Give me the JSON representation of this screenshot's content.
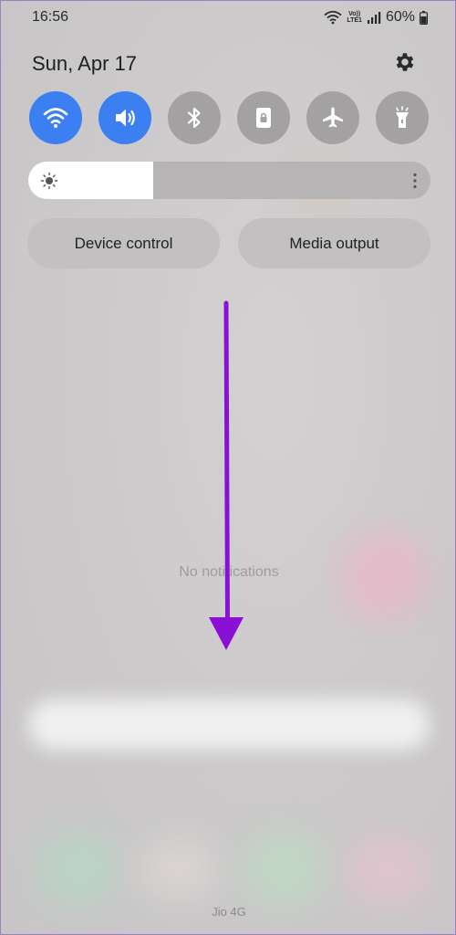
{
  "status_bar": {
    "time": "16:56",
    "volte_line1": "Vo))",
    "volte_line2": "LTE1",
    "battery": "60%"
  },
  "header": {
    "date": "Sun, Apr 17"
  },
  "quick_toggles": [
    {
      "name": "wifi",
      "icon": "wifi-icon",
      "state": "on"
    },
    {
      "name": "sound",
      "icon": "speaker-icon",
      "state": "on"
    },
    {
      "name": "bluetooth",
      "icon": "bluetooth-icon",
      "state": "off"
    },
    {
      "name": "sim",
      "icon": "lock-screen-icon",
      "state": "off"
    },
    {
      "name": "airplane",
      "icon": "airplane-icon",
      "state": "off"
    },
    {
      "name": "flashlight",
      "icon": "flashlight-icon",
      "state": "off"
    }
  ],
  "brightness": {
    "level": 0.31
  },
  "buttons": {
    "device_control": "Device control",
    "media_output": "Media output"
  },
  "notifications": {
    "empty_text": "No notifications"
  },
  "footer": {
    "carrier": "Jio 4G"
  },
  "colors": {
    "toggle_on": "#3b7ff0",
    "toggle_off": "#a3a1a2",
    "arrow": "#8a10d8"
  }
}
